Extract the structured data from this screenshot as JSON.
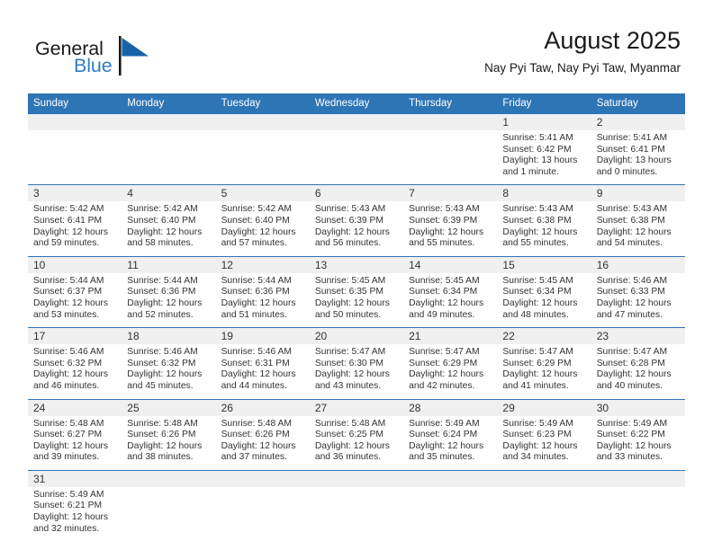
{
  "brand": {
    "name_part1": "General",
    "name_part2": "Blue",
    "logo_icon": "blue-flag-triangle",
    "color_primary": "#2e75b6",
    "color_text": "#1a1a1a"
  },
  "header": {
    "title": "August 2025",
    "subtitle": "Nay Pyi Taw, Nay Pyi Taw, Myanmar"
  },
  "calendar": {
    "weekday_headers": [
      "Sunday",
      "Monday",
      "Tuesday",
      "Wednesday",
      "Thursday",
      "Friday",
      "Saturday"
    ],
    "header_bg": "#2e75b6",
    "daynum_bg": "#f0f0f0",
    "weeks": [
      [
        {
          "day": "",
          "lines": []
        },
        {
          "day": "",
          "lines": []
        },
        {
          "day": "",
          "lines": []
        },
        {
          "day": "",
          "lines": []
        },
        {
          "day": "",
          "lines": []
        },
        {
          "day": "1",
          "lines": [
            "Sunrise: 5:41 AM",
            "Sunset: 6:42 PM",
            "Daylight: 13 hours",
            "and 1 minute."
          ]
        },
        {
          "day": "2",
          "lines": [
            "Sunrise: 5:41 AM",
            "Sunset: 6:41 PM",
            "Daylight: 13 hours",
            "and 0 minutes."
          ]
        }
      ],
      [
        {
          "day": "3",
          "lines": [
            "Sunrise: 5:42 AM",
            "Sunset: 6:41 PM",
            "Daylight: 12 hours",
            "and 59 minutes."
          ]
        },
        {
          "day": "4",
          "lines": [
            "Sunrise: 5:42 AM",
            "Sunset: 6:40 PM",
            "Daylight: 12 hours",
            "and 58 minutes."
          ]
        },
        {
          "day": "5",
          "lines": [
            "Sunrise: 5:42 AM",
            "Sunset: 6:40 PM",
            "Daylight: 12 hours",
            "and 57 minutes."
          ]
        },
        {
          "day": "6",
          "lines": [
            "Sunrise: 5:43 AM",
            "Sunset: 6:39 PM",
            "Daylight: 12 hours",
            "and 56 minutes."
          ]
        },
        {
          "day": "7",
          "lines": [
            "Sunrise: 5:43 AM",
            "Sunset: 6:39 PM",
            "Daylight: 12 hours",
            "and 55 minutes."
          ]
        },
        {
          "day": "8",
          "lines": [
            "Sunrise: 5:43 AM",
            "Sunset: 6:38 PM",
            "Daylight: 12 hours",
            "and 55 minutes."
          ]
        },
        {
          "day": "9",
          "lines": [
            "Sunrise: 5:43 AM",
            "Sunset: 6:38 PM",
            "Daylight: 12 hours",
            "and 54 minutes."
          ]
        }
      ],
      [
        {
          "day": "10",
          "lines": [
            "Sunrise: 5:44 AM",
            "Sunset: 6:37 PM",
            "Daylight: 12 hours",
            "and 53 minutes."
          ]
        },
        {
          "day": "11",
          "lines": [
            "Sunrise: 5:44 AM",
            "Sunset: 6:36 PM",
            "Daylight: 12 hours",
            "and 52 minutes."
          ]
        },
        {
          "day": "12",
          "lines": [
            "Sunrise: 5:44 AM",
            "Sunset: 6:36 PM",
            "Daylight: 12 hours",
            "and 51 minutes."
          ]
        },
        {
          "day": "13",
          "lines": [
            "Sunrise: 5:45 AM",
            "Sunset: 6:35 PM",
            "Daylight: 12 hours",
            "and 50 minutes."
          ]
        },
        {
          "day": "14",
          "lines": [
            "Sunrise: 5:45 AM",
            "Sunset: 6:34 PM",
            "Daylight: 12 hours",
            "and 49 minutes."
          ]
        },
        {
          "day": "15",
          "lines": [
            "Sunrise: 5:45 AM",
            "Sunset: 6:34 PM",
            "Daylight: 12 hours",
            "and 48 minutes."
          ]
        },
        {
          "day": "16",
          "lines": [
            "Sunrise: 5:46 AM",
            "Sunset: 6:33 PM",
            "Daylight: 12 hours",
            "and 47 minutes."
          ]
        }
      ],
      [
        {
          "day": "17",
          "lines": [
            "Sunrise: 5:46 AM",
            "Sunset: 6:32 PM",
            "Daylight: 12 hours",
            "and 46 minutes."
          ]
        },
        {
          "day": "18",
          "lines": [
            "Sunrise: 5:46 AM",
            "Sunset: 6:32 PM",
            "Daylight: 12 hours",
            "and 45 minutes."
          ]
        },
        {
          "day": "19",
          "lines": [
            "Sunrise: 5:46 AM",
            "Sunset: 6:31 PM",
            "Daylight: 12 hours",
            "and 44 minutes."
          ]
        },
        {
          "day": "20",
          "lines": [
            "Sunrise: 5:47 AM",
            "Sunset: 6:30 PM",
            "Daylight: 12 hours",
            "and 43 minutes."
          ]
        },
        {
          "day": "21",
          "lines": [
            "Sunrise: 5:47 AM",
            "Sunset: 6:29 PM",
            "Daylight: 12 hours",
            "and 42 minutes."
          ]
        },
        {
          "day": "22",
          "lines": [
            "Sunrise: 5:47 AM",
            "Sunset: 6:29 PM",
            "Daylight: 12 hours",
            "and 41 minutes."
          ]
        },
        {
          "day": "23",
          "lines": [
            "Sunrise: 5:47 AM",
            "Sunset: 6:28 PM",
            "Daylight: 12 hours",
            "and 40 minutes."
          ]
        }
      ],
      [
        {
          "day": "24",
          "lines": [
            "Sunrise: 5:48 AM",
            "Sunset: 6:27 PM",
            "Daylight: 12 hours",
            "and 39 minutes."
          ]
        },
        {
          "day": "25",
          "lines": [
            "Sunrise: 5:48 AM",
            "Sunset: 6:26 PM",
            "Daylight: 12 hours",
            "and 38 minutes."
          ]
        },
        {
          "day": "26",
          "lines": [
            "Sunrise: 5:48 AM",
            "Sunset: 6:26 PM",
            "Daylight: 12 hours",
            "and 37 minutes."
          ]
        },
        {
          "day": "27",
          "lines": [
            "Sunrise: 5:48 AM",
            "Sunset: 6:25 PM",
            "Daylight: 12 hours",
            "and 36 minutes."
          ]
        },
        {
          "day": "28",
          "lines": [
            "Sunrise: 5:49 AM",
            "Sunset: 6:24 PM",
            "Daylight: 12 hours",
            "and 35 minutes."
          ]
        },
        {
          "day": "29",
          "lines": [
            "Sunrise: 5:49 AM",
            "Sunset: 6:23 PM",
            "Daylight: 12 hours",
            "and 34 minutes."
          ]
        },
        {
          "day": "30",
          "lines": [
            "Sunrise: 5:49 AM",
            "Sunset: 6:22 PM",
            "Daylight: 12 hours",
            "and 33 minutes."
          ]
        }
      ],
      [
        {
          "day": "31",
          "lines": [
            "Sunrise: 5:49 AM",
            "Sunset: 6:21 PM",
            "Daylight: 12 hours",
            "and 32 minutes."
          ]
        },
        {
          "day": "",
          "lines": []
        },
        {
          "day": "",
          "lines": []
        },
        {
          "day": "",
          "lines": []
        },
        {
          "day": "",
          "lines": []
        },
        {
          "day": "",
          "lines": []
        },
        {
          "day": "",
          "lines": []
        }
      ]
    ]
  }
}
